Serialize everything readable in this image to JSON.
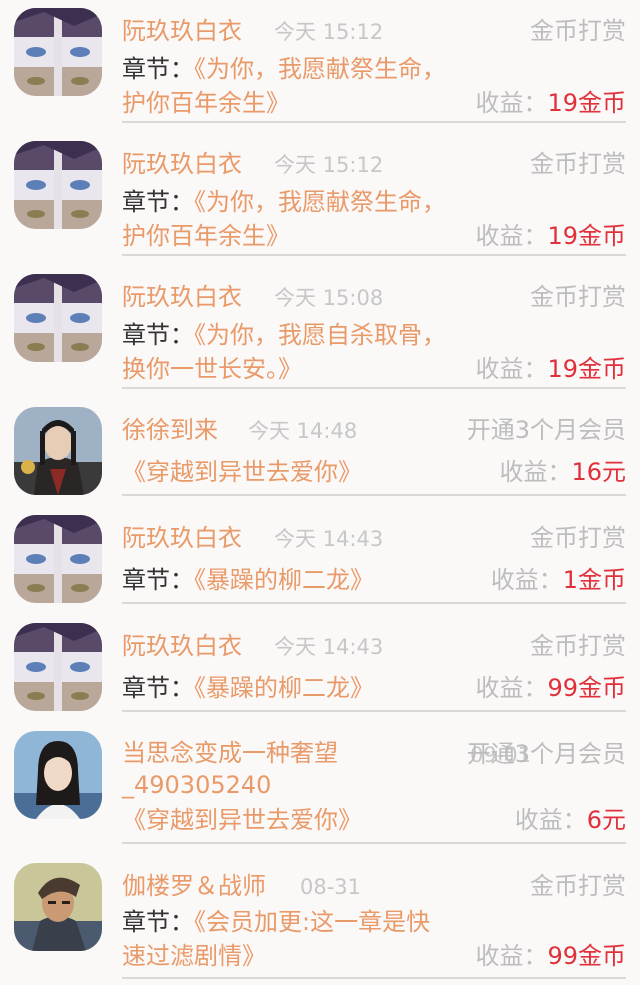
{
  "labels": {
    "chapter_prefix": "章节：",
    "income_prefix": "收益："
  },
  "colors": {
    "name": "#e99a69",
    "income_value": "#e0303a",
    "muted": "#bdbdbd"
  },
  "items": [
    {
      "avatar": "anime-character-avatar",
      "name": "阮玖玖白衣",
      "time": "今天 15:12",
      "type": "金币打赏",
      "has_chapter_label": true,
      "chapter": "《为你，我愿献祭生命，护你百年余生》",
      "income": "19金币"
    },
    {
      "avatar": "anime-character-avatar",
      "name": "阮玖玖白衣",
      "time": "今天 15:12",
      "type": "金币打赏",
      "has_chapter_label": true,
      "chapter": "《为你，我愿献祭生命，护你百年余生》",
      "income": "19金币"
    },
    {
      "avatar": "anime-character-avatar",
      "name": "阮玖玖白衣",
      "time": "今天 15:08",
      "type": "金币打赏",
      "has_chapter_label": true,
      "chapter": "《为你，我愿自杀取骨，换你一世长安。》",
      "income": "19金币"
    },
    {
      "avatar": "ancient-costume-avatar",
      "name": "徐徐到来",
      "time": "今天 14:48",
      "type": "开通3个月会员",
      "has_chapter_label": false,
      "chapter": "《穿越到异世去爱你》",
      "income": "16元"
    },
    {
      "avatar": "anime-character-avatar",
      "name": "阮玖玖白衣",
      "time": "今天 14:43",
      "type": "金币打赏",
      "has_chapter_label": true,
      "chapter": "《暴躁的柳二龙》",
      "income": "1金币"
    },
    {
      "avatar": "anime-character-avatar",
      "name": "阮玖玖白衣",
      "time": "今天 14:43",
      "type": "金币打赏",
      "has_chapter_label": true,
      "chapter": "《暴躁的柳二龙》",
      "income": "99金币"
    },
    {
      "avatar": "girl-photo-avatar",
      "name": "当思念变成一种奢望_490305240",
      "time": "09-01",
      "type": "开通3个月会员",
      "has_chapter_label": false,
      "chapter": "《穿越到异世去爱你》",
      "income": "6元"
    },
    {
      "avatar": "warrior-illustration-avatar",
      "name": "伽楼罗＆战师",
      "time": "08-31",
      "type": "金币打赏",
      "has_chapter_label": true,
      "chapter": "《会员加更:这一章是快速过滤剧情》",
      "income": "99金币"
    }
  ]
}
